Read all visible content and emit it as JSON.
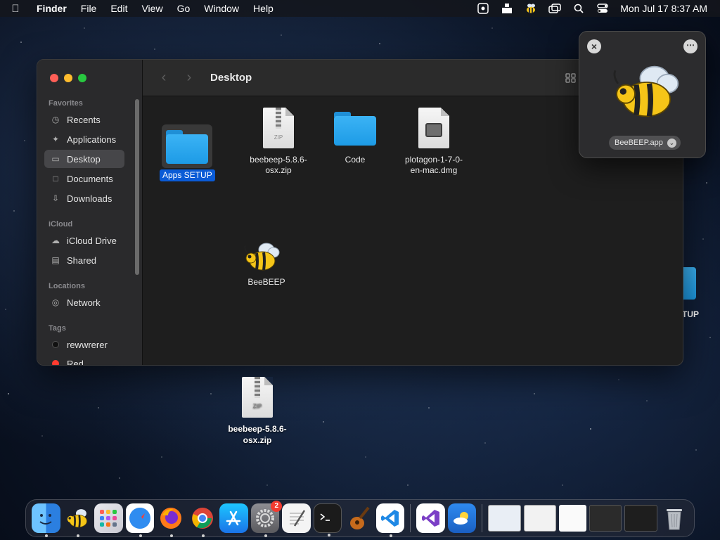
{
  "menubar": {
    "app_name": "Finder",
    "menus": [
      "File",
      "Edit",
      "View",
      "Go",
      "Window",
      "Help"
    ],
    "clock": "Mon Jul 17  8:37 AM"
  },
  "finder": {
    "title": "Desktop",
    "sidebar": {
      "favorites_header": "Favorites",
      "favorites": [
        {
          "label": "Recents",
          "icon": "clock-icon"
        },
        {
          "label": "Applications",
          "icon": "applications-icon"
        },
        {
          "label": "Desktop",
          "icon": "desktop-icon",
          "active": true
        },
        {
          "label": "Documents",
          "icon": "document-icon"
        },
        {
          "label": "Downloads",
          "icon": "download-icon"
        }
      ],
      "icloud_header": "iCloud",
      "icloud": [
        {
          "label": "iCloud Drive",
          "icon": "cloud-icon"
        },
        {
          "label": "Shared",
          "icon": "shared-folder-icon"
        }
      ],
      "locations_header": "Locations",
      "locations": [
        {
          "label": "Network",
          "icon": "globe-icon"
        }
      ],
      "tags_header": "Tags",
      "tags": [
        {
          "label": "rewwrerer",
          "color": "#000000"
        },
        {
          "label": "Red",
          "color": "#ff3b30"
        }
      ]
    },
    "files": [
      {
        "name": "Apps SETUP",
        "kind": "folder",
        "selected": true
      },
      {
        "name_line1": "beebeep-5.8.6-",
        "name_line2": "osx.zip",
        "kind": "zip",
        "zip_label": "ZIP"
      },
      {
        "name": "Code",
        "kind": "folder"
      },
      {
        "name_line1": "plotagon-1-7-0-",
        "name_line2": "en-mac.dmg",
        "kind": "dmg"
      },
      {
        "name": "BeeBEEP",
        "kind": "app"
      }
    ]
  },
  "quicklook": {
    "file_name": "BeeBEEP.app"
  },
  "desktop": {
    "zip_name_line1": "beebeep-5.8.6-",
    "zip_name_line2": "osx.zip",
    "zip_label": "ZIP",
    "partial_label": "TUP"
  },
  "dock": {
    "settings_badge": "2"
  },
  "colors": {
    "accent": "#0a5bd6",
    "folder": "#2aa7ee",
    "finder_bg": "#1e1e1e",
    "sidebar_bg": "#2a2a2c"
  }
}
